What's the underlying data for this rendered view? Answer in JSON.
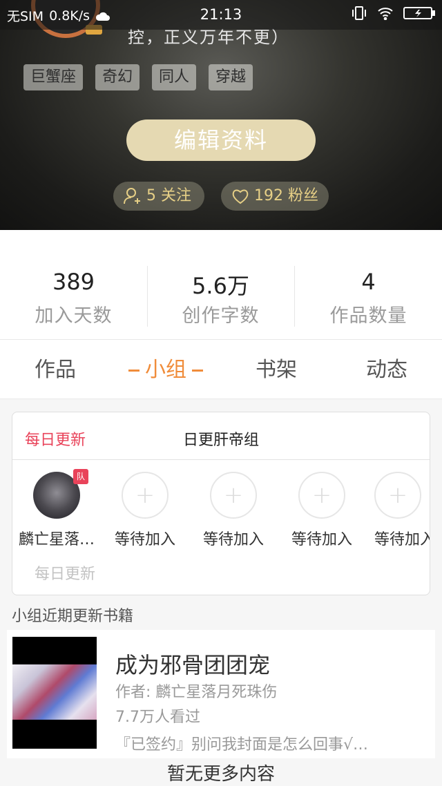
{
  "status_bar": {
    "carrier": "无SIM",
    "speed": "0.8K/s",
    "time": "21:13"
  },
  "profile": {
    "bio_fragment": "控，正义万年不更）",
    "tags": [
      "巨蟹座",
      "奇幻",
      "同人",
      "穿越"
    ],
    "edit_label": "编辑资料",
    "follow_label": "5 关注",
    "fans_label": "192 粉丝"
  },
  "stats": [
    {
      "value": "389",
      "label": "加入天数"
    },
    {
      "value": "5.6万",
      "label": "创作字数"
    },
    {
      "value": "4",
      "label": "作品数量"
    }
  ],
  "tabs": [
    "作品",
    "小组",
    "书架",
    "动态"
  ],
  "active_tab": "小组",
  "group": {
    "update_label": "每日更新",
    "name": "日更肝帝组",
    "badge": "队",
    "members": [
      {
        "name": "麟亡星落…",
        "filled": true
      },
      {
        "name": "等待加入",
        "filled": false
      },
      {
        "name": "等待加入",
        "filled": false
      },
      {
        "name": "等待加入",
        "filled": false
      },
      {
        "name": "等待加入",
        "filled": false
      }
    ],
    "footer": "每日更新"
  },
  "recent": {
    "title": "小组近期更新书籍",
    "book": {
      "title": "成为邪骨团团宠",
      "author": "作者: 麟亡星落月死珠伤",
      "views": "7.7万人看过",
      "desc": "『已签约』别问我封面是怎么回事√…"
    }
  },
  "no_more": "暂无更多内容",
  "colors": {
    "accent_orange": "#f08c3a",
    "update_red": "#e9435a",
    "edit_button": "#e5d9b2",
    "pill_text": "#e6cf86"
  }
}
